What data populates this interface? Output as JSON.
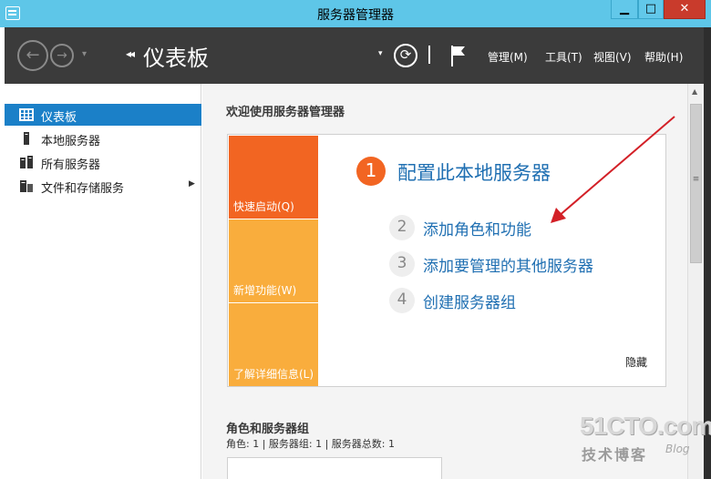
{
  "window": {
    "title": "服务器管理器",
    "controls": {
      "minimize": "▁",
      "maximize": "□",
      "close": "✕"
    }
  },
  "header": {
    "breadcrumb_chevron": "◂◂",
    "breadcrumb_title": "仪表板",
    "dropdown_glyph": "▾",
    "menus": {
      "manage": "管理(M)",
      "tools": "工具(T)",
      "view": "视图(V)",
      "help": "帮助(H)"
    },
    "icons": [
      "back-arrow-icon",
      "forward-arrow-icon",
      "refresh-icon",
      "flag-icon"
    ]
  },
  "sidebar": {
    "items": [
      {
        "label": "仪表板",
        "icon": "dashboard-icon",
        "selected": true
      },
      {
        "label": "本地服务器",
        "icon": "server-icon"
      },
      {
        "label": "所有服务器",
        "icon": "servers-icon"
      },
      {
        "label": "文件和存储服务",
        "icon": "storage-icon",
        "has_submenu": true
      }
    ]
  },
  "main": {
    "welcome": "欢迎使用服务器管理器",
    "tiles": {
      "quick": "快速启动(Q)",
      "new": "新增功能(W)",
      "learn": "了解详细信息(L)"
    },
    "steps": [
      {
        "num": "1",
        "label": "配置此本地服务器"
      },
      {
        "num": "2",
        "label": "添加角色和功能"
      },
      {
        "num": "3",
        "label": "添加要管理的其他服务器"
      },
      {
        "num": "4",
        "label": "创建服务器组"
      }
    ],
    "hide": "隐藏",
    "roles_title": "角色和服务器组",
    "roles_summary": "角色: 1 | 服务器组: 1 | 服务器总数: 1"
  },
  "watermark": {
    "logo": "51CTO.com",
    "sub": "技术博客",
    "blog": "Blog"
  },
  "colors": {
    "titlebar": "#5ec6e8",
    "header": "#3b3b3b",
    "selection": "#1b80c8",
    "tile_orange": "#f26522",
    "tile_yellow": "#f9ad3d",
    "link_blue": "#1f6fb2",
    "annotation_arrow": "#d32027"
  }
}
